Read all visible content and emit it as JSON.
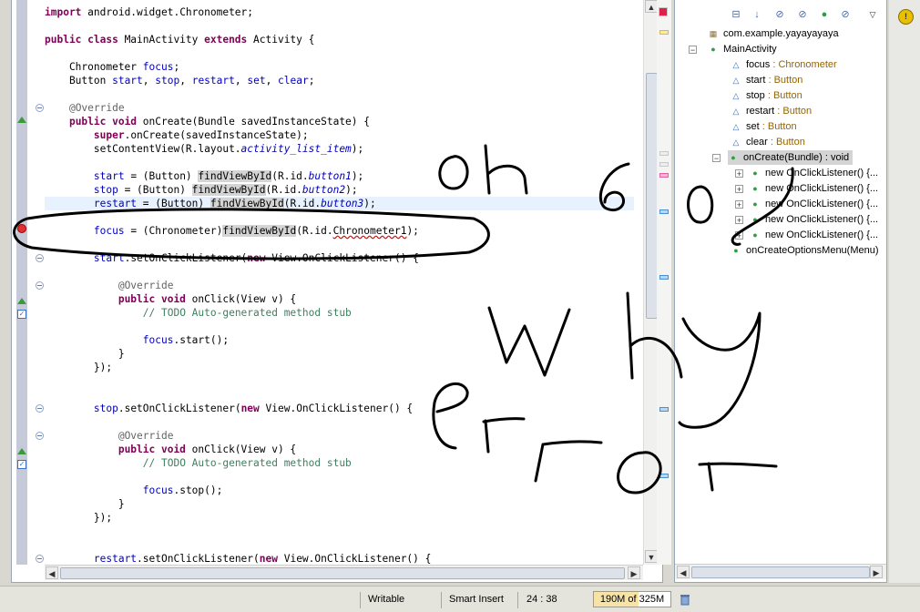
{
  "editor": {
    "lines": [
      {
        "html": "<span class=\"kw\">import</span> android.widget.Chronometer;"
      },
      {
        "html": ""
      },
      {
        "html": "<span class=\"kw\">public class</span> MainActivity <span class=\"kw\">extends</span> Activity {"
      },
      {
        "html": ""
      },
      {
        "html": "    Chronometer <span class=\"fld\">focus</span>;"
      },
      {
        "html": "    Button <span class=\"fld\">start</span>, <span class=\"fld\">stop</span>, <span class=\"fld\">restart</span>, <span class=\"fld\">set</span>, <span class=\"fld\">clear</span>;"
      },
      {
        "html": ""
      },
      {
        "html": "    <span class=\"ann\">@Override</span>"
      },
      {
        "html": "    <span class=\"kw\">public void</span> onCreate(Bundle savedInstanceState) {"
      },
      {
        "html": "        <span class=\"kw\">super</span>.onCreate(savedInstanceState);"
      },
      {
        "html": "        setContentView(R.layout.<span class=\"it\">activity_list_item</span>);"
      },
      {
        "html": ""
      },
      {
        "html": "        <span class=\"fld\">start</span> = (Button) <span class=\"occ\">findViewById</span>(R.id.<span class=\"it\">button1</span>);"
      },
      {
        "html": "        <span class=\"fld\">stop</span> = (Button) <span class=\"occ\">findViewById</span>(R.id.<span class=\"it\">button2</span>);"
      },
      {
        "html": "        <span class=\"fld\">restart</span> = (Button) <span class=\"occ\">findViewById</span>(R.id.<span class=\"it\">button3</span>);"
      },
      {
        "html": ""
      },
      {
        "html": "        <span class=\"fld\">focus</span> = (Chronometer)<span class=\"occ\">findViewById</span>(R.id.<span class=\"err\">Chronometer1</span>);"
      },
      {
        "html": ""
      },
      {
        "html": "        <span class=\"fld\">start</span>.setOnClickListener(<span class=\"kw\">new</span> View.OnClickListener() {"
      },
      {
        "html": ""
      },
      {
        "html": "            <span class=\"ann\">@Override</span>"
      },
      {
        "html": "            <span class=\"kw\">public void</span> onClick(View v) {"
      },
      {
        "html": "                <span class=\"cmt\">// TODO Auto-generated method stub</span>"
      },
      {
        "html": ""
      },
      {
        "html": "                <span class=\"fld\">focus</span>.start();"
      },
      {
        "html": "            }"
      },
      {
        "html": "        });"
      },
      {
        "html": ""
      },
      {
        "html": ""
      },
      {
        "html": "        <span class=\"fld\">stop</span>.setOnClickListener(<span class=\"kw\">new</span> View.OnClickListener() {"
      },
      {
        "html": ""
      },
      {
        "html": "            <span class=\"ann\">@Override</span>"
      },
      {
        "html": "            <span class=\"kw\">public void</span> onClick(View v) {"
      },
      {
        "html": "                <span class=\"cmt\">// TODO Auto-generated method stub</span>"
      },
      {
        "html": ""
      },
      {
        "html": "                <span class=\"fld\">focus</span>.stop();"
      },
      {
        "html": "            }"
      },
      {
        "html": "        });"
      },
      {
        "html": ""
      },
      {
        "html": ""
      },
      {
        "html": "        <span class=\"fld\">restart</span>.setOnClickListener(<span class=\"kw\">new</span> View.OnClickListener() {"
      }
    ]
  },
  "outline": {
    "package": "com.example.yayayayaya",
    "class": "MainActivity",
    "fields": [
      {
        "name": "focus",
        "type": " : Chronometer"
      },
      {
        "name": "start",
        "type": " : Button"
      },
      {
        "name": "stop",
        "type": " : Button"
      },
      {
        "name": "restart",
        "type": " : Button"
      },
      {
        "name": "set",
        "type": " : Button"
      },
      {
        "name": "clear",
        "type": " : Button"
      }
    ],
    "method": "onCreate(Bundle) : void",
    "listeners": [
      "new OnClickListener() {...",
      "new OnClickListener() {...",
      "new OnClickListener() {...",
      "new OnClickListener() {...",
      "new OnClickListener() {..."
    ],
    "method2": "onCreateOptionsMenu(Menu)"
  },
  "status": {
    "writable": "Writable",
    "insert_mode": "Smart Insert",
    "position": "24 : 38",
    "heap": "190M of 325M",
    "heap_fraction": 0.585
  },
  "handwriting": {
    "words": [
      "oh",
      "6",
      "o",
      "why",
      "error"
    ],
    "color": "#000000"
  }
}
